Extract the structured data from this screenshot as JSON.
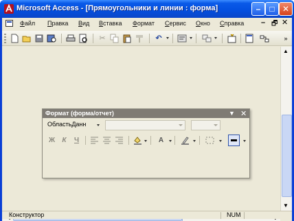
{
  "window": {
    "title": "Microsoft Access - [Прямоугольники и линии : форма]",
    "min_glyph": "–",
    "max_glyph": "□",
    "close_glyph": "✕"
  },
  "menu": {
    "items": [
      "Файл",
      "Правка",
      "Вид",
      "Вставка",
      "Формат",
      "Сервис",
      "Окно",
      "Справка"
    ],
    "mdi_min": "–",
    "mdi_restore": "🗗",
    "mdi_close": "✕"
  },
  "toolbar": {
    "icons": [
      "new-icon",
      "open-icon",
      "save-icon",
      "file-search-icon",
      "print-icon",
      "print-preview-icon",
      "cut-icon",
      "copy-icon",
      "paste-icon",
      "format-painter-icon",
      "undo-icon",
      "view-icon",
      "object-type-icon",
      "field-list-icon",
      "properties-icon",
      "build-icon"
    ]
  },
  "format_toolbar": {
    "title": "Формат (форма/отчет)",
    "object_combo_value": "ОбластьДанн",
    "font_combo_value": "",
    "size_combo_value": "",
    "bold": "Ж",
    "italic": "К",
    "underline": "Ч",
    "fill_color": "#808080",
    "font_color": "#808080",
    "line_color": "#808080"
  },
  "status": {
    "mode": "Конструктор",
    "num": "NUM"
  },
  "colors": {
    "titlebar": "#0a5ae8",
    "face": "#ece9d8",
    "scroll_thumb": "#c9d7f5"
  }
}
